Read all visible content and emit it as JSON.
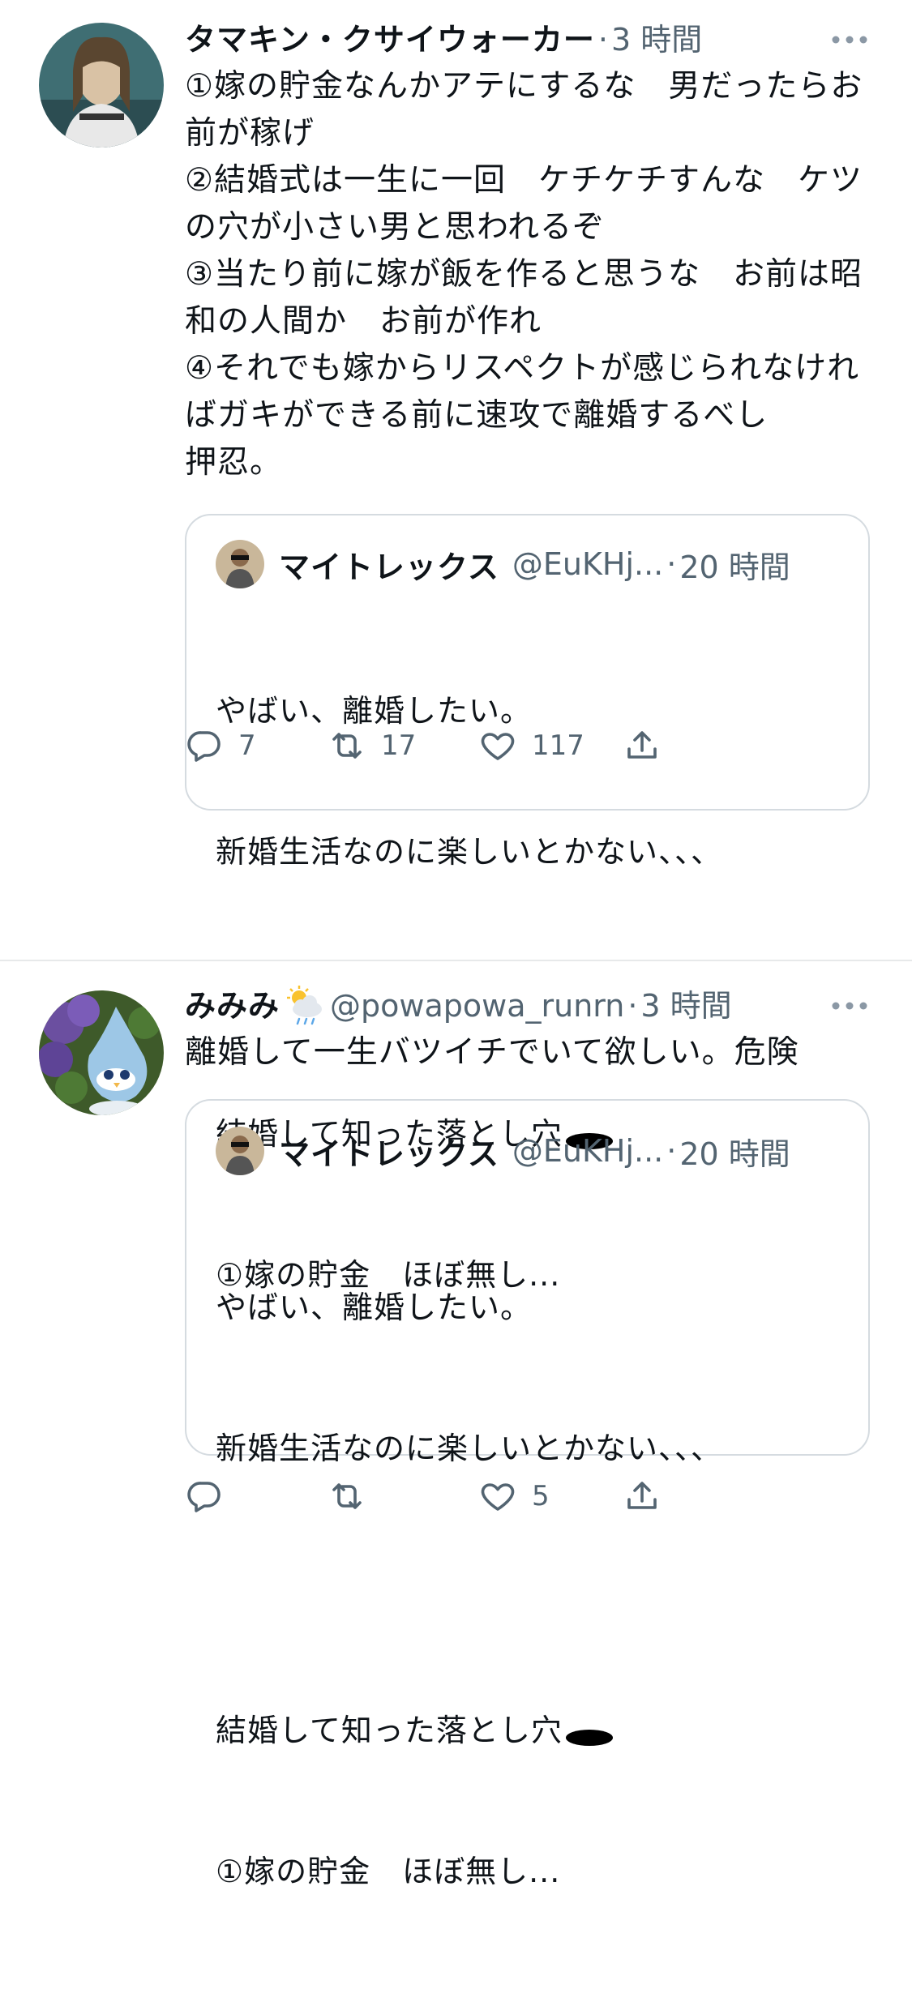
{
  "tweets": [
    {
      "name": "タマキン・クサイウォーカー",
      "handle": "",
      "time": "3 時間",
      "text": "①嫁の貯金なんかアテにするな　男だったらお前が稼げ\n②結婚式は一生に一回　ケチケチすんな　ケツの穴が小さい男と思われるぞ\n③当たり前に嫁が飯を作ると思うな　お前は昭和の人間か　お前が作れ\n④それでも嫁からリスペクトが感じられなければガキができる前に速攻で離婚するべし\n押忍。",
      "quote": {
        "name": "マイトレックス",
        "handle": "@EuKHj...",
        "time": "20 時間",
        "text_line1": "やばい、離婚したい。",
        "text_line2": "新婚生活なのに楽しいとかない、、、",
        "text_line3": "結婚して知った落とし穴",
        "text_line4": "①嫁の貯金　ほぼ無し..."
      },
      "actions": {
        "reply": "7",
        "retweet": "17",
        "like": "117",
        "share": ""
      }
    },
    {
      "name": "みみみ",
      "handle": "@powapowa_runrn",
      "time": "3 時間",
      "text": "離婚して一生バツイチでいて欲しい。危険",
      "quote": {
        "name": "マイトレックス",
        "handle": "@EuKHj...",
        "time": "20 時間",
        "text_line1": "やばい、離婚したい。",
        "text_line2": "新婚生活なのに楽しいとかない、、、",
        "text_line3": "結婚して知った落とし穴",
        "text_line4": "①嫁の貯金　ほぼ無し..."
      },
      "actions": {
        "reply": "",
        "retweet": "",
        "like": "5",
        "share": ""
      }
    }
  ],
  "separator": "·",
  "icons": {
    "more": "more-horizontal-icon",
    "reply": "reply-icon",
    "retweet": "retweet-icon",
    "like": "heart-icon",
    "share": "share-icon",
    "weather": "sun-behind-rain-cloud-emoji"
  },
  "colors": {
    "text": "#0f1419",
    "secondary": "#536471",
    "border": "#d5dbe0"
  }
}
